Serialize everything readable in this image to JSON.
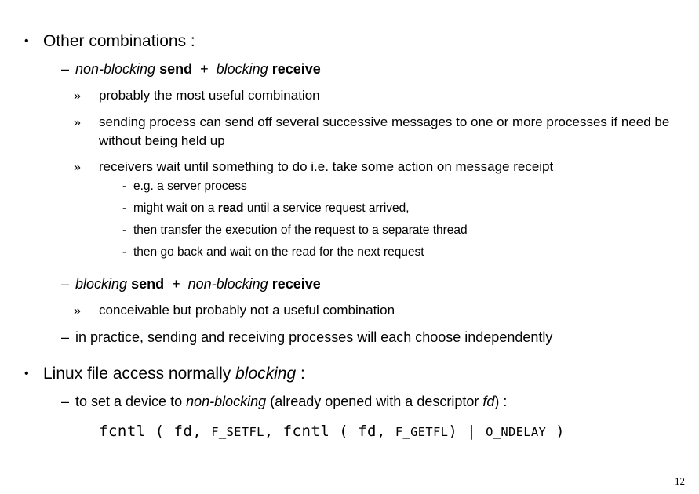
{
  "slide": {
    "page_number": "12",
    "background_color": "#ffffff",
    "text_color": "#000000",
    "markers": {
      "level1": "•",
      "level2": "–",
      "level3": "»",
      "level4": "-"
    },
    "blocks": {
      "b1_other_combinations": "Other combinations :",
      "b2_nonblocking_send": {
        "part1": "non-blocking",
        "part2": "send",
        "part3": "+",
        "part4": "blocking",
        "part5": "receive"
      },
      "b3_probably": "probably the most useful combination",
      "b4_sending_process": "sending process can send off several successive messages to one or more processes if need be without being held up",
      "b5_receivers_wait": "receivers wait until something to do i.e. take some action on message receipt",
      "b6_eg_server": "e.g. a server process",
      "b7_might_wait": {
        "part1": "might",
        "part2": "wait",
        "part3": "on a",
        "part4": "read",
        "part5": "until a service request arrived,"
      },
      "b8_then_transfer": "then transfer the execution of the request to a separate thread",
      "b9_then_go_back": {
        "part1": "then go back and",
        "part2": "wait",
        "part3": "on the read for the next request"
      },
      "b10_blocking_send": {
        "part1": "blocking",
        "part2": "send",
        "part3": "+",
        "part4": "non-blocking",
        "part5": "receive"
      },
      "b11_conceivable": "conceivable but probably not a useful combination",
      "b12_in_practice": "in practice, sending and receiving processes will each choose independently",
      "b13_linux_file_access": {
        "part1": "Linux file access normally",
        "part2": "blocking",
        "part3": ":"
      },
      "b14_to_set_device": {
        "part1": "to set a device to",
        "part2": "non-blocking",
        "part3": "(already opened with a descriptor",
        "part4": "fd",
        "part5": ") :"
      },
      "b15_code": {
        "seg1": "fcntl ( fd, ",
        "seg2": "F_SETFL",
        "seg3": ", fcntl ( fd, ",
        "seg4": "F_GETFL",
        "seg5": ") | ",
        "seg6": "O_NDELAY",
        "seg7": " )"
      }
    }
  }
}
